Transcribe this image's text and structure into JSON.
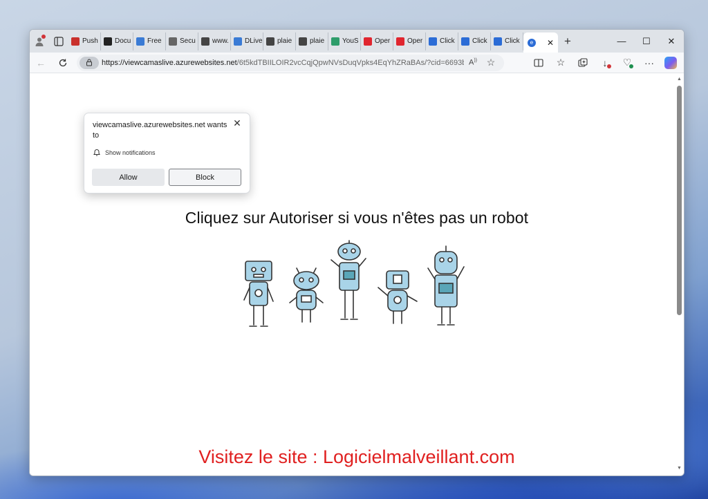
{
  "browser": {
    "tabs": [
      {
        "label": "Push",
        "favicon_color": "#c9302c"
      },
      {
        "label": "Docu",
        "favicon_color": "#222222"
      },
      {
        "label": "Free",
        "favicon_color": "#3a7bd5"
      },
      {
        "label": "Secu",
        "favicon_color": "#666666"
      },
      {
        "label": "www.",
        "favicon_color": "#444444"
      },
      {
        "label": "DLive",
        "favicon_color": "#3a7bd5"
      },
      {
        "label": "plaie",
        "favicon_color": "#444444"
      },
      {
        "label": "plaie",
        "favicon_color": "#444444"
      },
      {
        "label": "YouS",
        "favicon_color": "#2e9d6b"
      },
      {
        "label": "Oper",
        "favicon_color": "#e0262f"
      },
      {
        "label": "Oper",
        "favicon_color": "#e0262f"
      },
      {
        "label": "Click",
        "favicon_color": "#2b6cd6"
      },
      {
        "label": "Click",
        "favicon_color": "#2b6cd6"
      },
      {
        "label": "Click",
        "favicon_color": "#2b6cd6"
      }
    ],
    "active_tab_favicon_color": "#2b6cd6",
    "address_bar": {
      "host": "https://viewcamaslive.azurewebsites.net",
      "path": "/6t5kdTBIILOIR2vcCqjQpwNVsDuqVpks4EqYhZRaBAs/?cid=6693bc..."
    }
  },
  "popup": {
    "title": "viewcamaslive.azurewebsites.net wants to",
    "permission": "Show notifications",
    "allow_label": "Allow",
    "block_label": "Block"
  },
  "page": {
    "headline": "Cliquez sur Autoriser si vous n'êtes pas un robot",
    "watermark": "Visitez le site : Logicielmalveillant.com",
    "robot_color": "#a9d4e8"
  }
}
